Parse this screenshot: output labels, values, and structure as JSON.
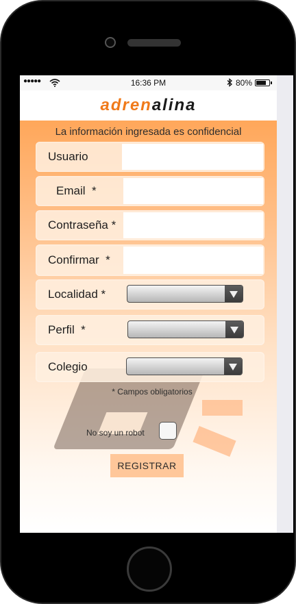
{
  "status_bar": {
    "signal": "●●●●●",
    "time": "16:36 PM",
    "battery_percent": "80%",
    "battery_level": 0.8
  },
  "header": {
    "logo_part1": "adren",
    "logo_part2": "alina"
  },
  "form": {
    "notice": "La información ingresada es confidencial",
    "fields": {
      "usuario": {
        "label": "Usuario",
        "value": ""
      },
      "email": {
        "label": "Email  *",
        "value": ""
      },
      "contrasena": {
        "label": "Contraseña *",
        "value": ""
      },
      "confirmar": {
        "label": "Confirmar  *",
        "value": ""
      }
    },
    "selects": {
      "localidad": {
        "label": "Localidad *",
        "value": ""
      },
      "perfil": {
        "label": "Perfil  *",
        "value": ""
      },
      "colegio": {
        "label": "Colegio",
        "value": ""
      }
    },
    "required_note": "* Campos obligatorios",
    "captcha_label": "No soy un robot",
    "register_label": "REGISTRAR"
  },
  "colors": {
    "accent": "#f07a1a",
    "button_bg": "#ffc79a"
  },
  "icons": {
    "wifi": "wifi-icon",
    "bluetooth": "bluetooth-icon",
    "battery": "battery-icon",
    "dropdown": "chevron-down-icon"
  }
}
